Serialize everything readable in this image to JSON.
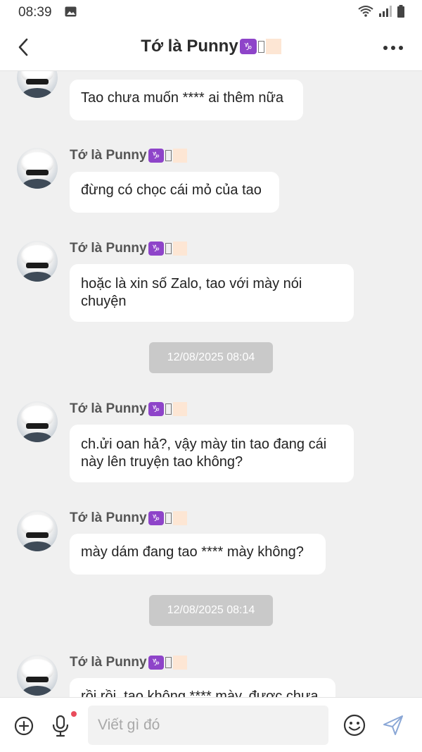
{
  "status_bar": {
    "time": "08:39",
    "icons": [
      "gallery-icon",
      "wifi-icon",
      "signal-icon",
      "battery-icon"
    ]
  },
  "header": {
    "title": "Tớ là Punny",
    "title_badge": "♑",
    "back_icon": "back-chevron-icon",
    "more_icon": "more-dots-icon"
  },
  "messages": [
    {
      "sender": "",
      "text": "Tao chưa muốn **** ai thêm nữa"
    },
    {
      "sender": "Tớ là Punny",
      "badge": "♑",
      "text": "đừng có chọc cái mỏ của tao"
    },
    {
      "sender": "Tớ là Punny",
      "badge": "♑",
      "text": "hoặc là xin số Zalo, tao với mày nói chuyện"
    },
    {
      "sender": "Tớ là Punny",
      "badge": "♑",
      "text": "ch.ửi oan hả?, vậy mày tin tao đang cái này lên truyện tao không?"
    },
    {
      "sender": "Tớ là Punny",
      "badge": "♑",
      "text": "mày dám đang tao **** mày không?"
    },
    {
      "sender": "Tớ là Punny",
      "badge": "♑",
      "text": "rồi rồi, tao không **** mày, được chưa"
    }
  ],
  "timestamps": [
    "12/08/2025 08:04",
    "12/08/2025 08:14"
  ],
  "input_bar": {
    "placeholder": "Viết gì đó",
    "value": "",
    "icons": [
      "add-circle-icon",
      "microphone-icon",
      "emoji-icon",
      "send-icon"
    ]
  },
  "colors": {
    "badge_purple": "#8e44c9",
    "chat_background": "#f0f0f0",
    "bubble": "#ffffff",
    "timestamp_pill": "#c9c9c9",
    "mic_dot": "#e94b5b"
  }
}
